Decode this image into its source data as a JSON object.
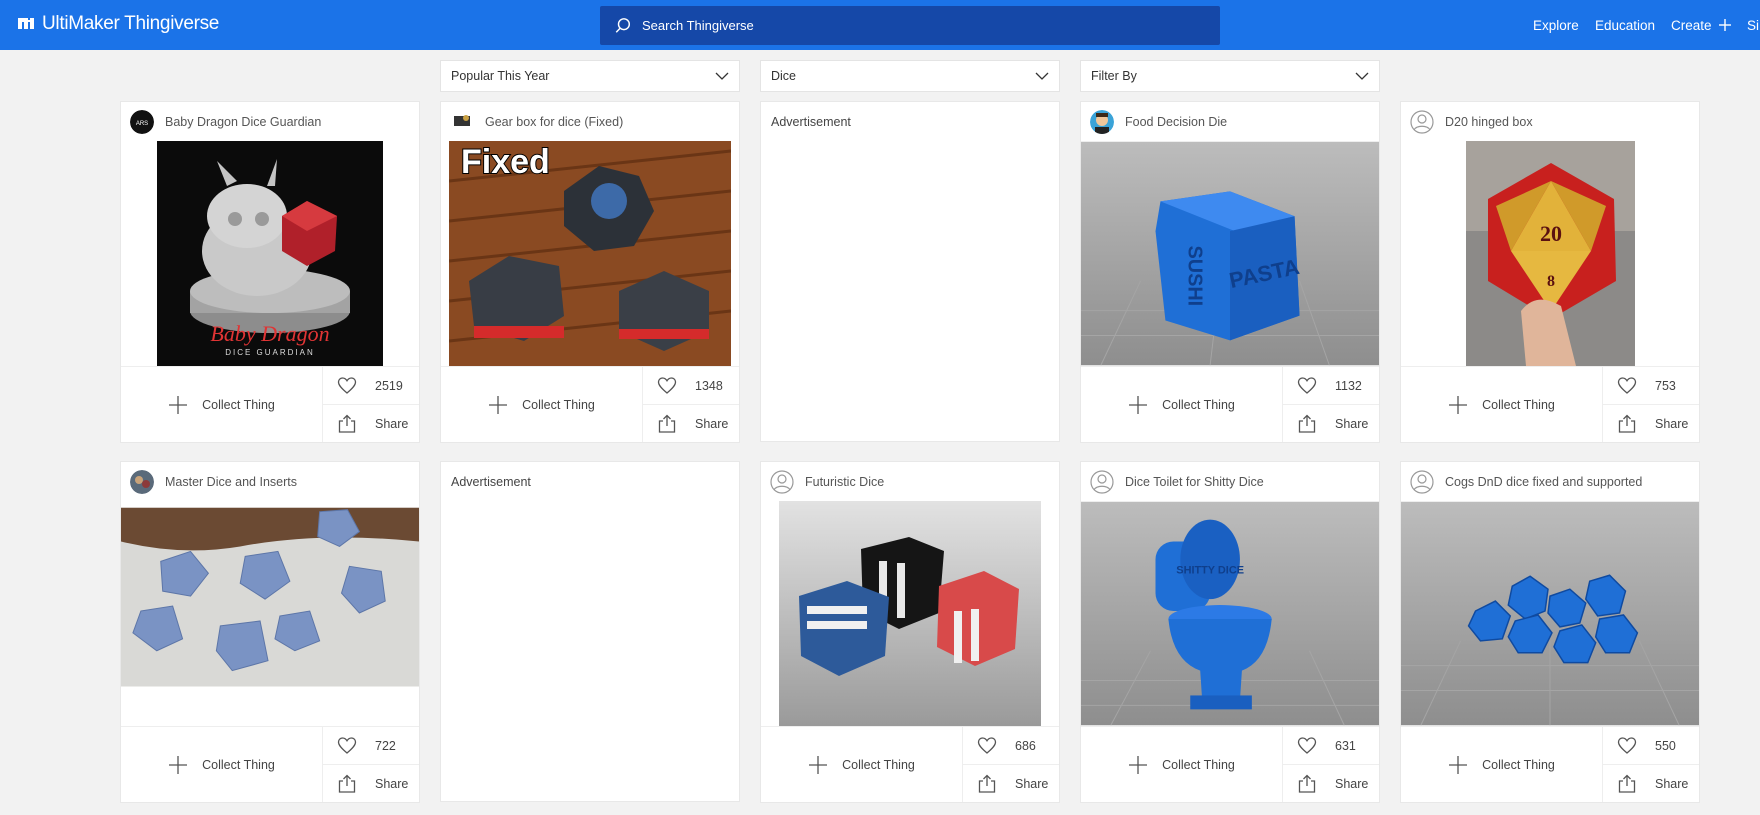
{
  "header": {
    "logo": "UltiMaker Thingiverse",
    "search_placeholder": "Search Thingiverse",
    "nav": {
      "explore": "Explore",
      "education": "Education",
      "create": "Create",
      "sign": "Si"
    }
  },
  "filters": {
    "sort": "Popular This Year",
    "category": "Dice",
    "filter_by": "Filter By"
  },
  "actions": {
    "collect_label": "Collect Thing",
    "share_label": "Share"
  },
  "ads": {
    "label": "Advertisement"
  },
  "cards": [
    {
      "title": "Baby Dragon Dice Guardian",
      "likes": "2519",
      "thumb_text": "Baby Dragon",
      "thumb_subtext": "DICE GUARDIAN"
    },
    {
      "title": "Gear box for dice (Fixed)",
      "likes": "1348",
      "thumb_text": "Fixed"
    },
    {
      "title": "Food Decision Die",
      "likes": "1132",
      "thumb_text": "PASTA",
      "thumb_text2": "SUSHI"
    },
    {
      "title": "D20 hinged box",
      "likes": "753",
      "thumb_text": "20",
      "thumb_text2": "8"
    },
    {
      "title": "Master Dice and Inserts",
      "likes": "722"
    },
    {
      "title": "Futuristic Dice",
      "likes": "686"
    },
    {
      "title": "Dice Toilet for Shitty Dice",
      "likes": "631",
      "thumb_text": "SHITTY DICE"
    },
    {
      "title": "Cogs DnD dice fixed and supported",
      "likes": "550"
    }
  ],
  "colors": {
    "header_bg": "#1b73e8",
    "search_bg": "#1548a8",
    "page_bg": "#f2f2f2"
  }
}
